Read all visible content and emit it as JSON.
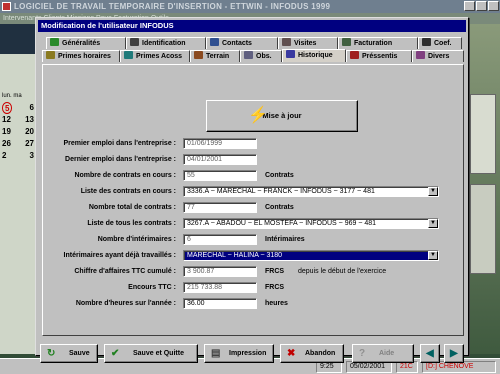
{
  "app": {
    "title": "LOGICIEL DE TRAVAIL TEMPORAIRE D'INSERTION - ETTWIN - INFODUS 1999",
    "menu": "Intervenants   Clients   Missions   Paye   Facturation   Outils",
    "calendar": {
      "header": "lun.  ma",
      "days": [
        "5",
        "12",
        "19",
        "26",
        "2"
      ],
      "rows_right": [
        "6",
        "13",
        "20",
        "27",
        "3"
      ]
    }
  },
  "dialog": {
    "title": "Modification de l'utilisateur INFODUS",
    "tabs_row1": [
      "Généralités",
      "Identification",
      "Contacts",
      "Visites",
      "Facturation",
      "Coef."
    ],
    "tabs_row2": [
      "Primes horaires",
      "Primes Acoss",
      "Terrain",
      "Obs.",
      "Historique",
      "Préssentis",
      "Divers"
    ],
    "update_button": "Mise à jour",
    "fields": {
      "premier_emploi": {
        "label": "Premier emploi dans l'entreprise :",
        "value": "01/06/1999"
      },
      "dernier_emploi": {
        "label": "Dernier emploi dans l'entreprise :",
        "value": "04/01/2001"
      },
      "nb_contrats_en_cours": {
        "label": "Nombre de contrats en cours :",
        "value": "55",
        "unit": "Contrats"
      },
      "liste_contrats_en_cours": {
        "label": "Liste des contrats en cours :",
        "value": "3336.A ~ MARECHAL ~ FRANCK ~ INFODUS ~ 3177 ~ 481"
      },
      "nb_total_contrats": {
        "label": "Nombre total de contrats :",
        "value": "77",
        "unit": "Contrats"
      },
      "liste_tous_contrats": {
        "label": "Liste de tous les contrats :",
        "value": "3267.A ~ ABADOU ~ EL MOSTEFA ~ INFODUS ~ 969 ~ 481"
      },
      "nb_interimaires": {
        "label": "Nombre d'intérimaires :",
        "value": "6",
        "unit": "Intérimaires"
      },
      "interimaires_travailles": {
        "label": "Intérimaires ayant déjà travaillés :",
        "value": "MARECHAL ~ HALINA ~ 3180"
      },
      "chiffre_affaires": {
        "label": "Chiffre d'affaires TTC cumulé :",
        "value": "3 900.87",
        "unit": "FRCS",
        "note": "depuis le début de l'exercice"
      },
      "encours_ttc": {
        "label": "Encours TTC :",
        "value": "215 733.88",
        "unit": "FRCS"
      },
      "nb_heures_annee": {
        "label": "Nombre d'heures sur l'année :",
        "value": "36.00",
        "unit": "heures"
      }
    },
    "buttons": {
      "sauve": "Sauve",
      "sauve_quitte": "Sauve et Quitte",
      "impression": "Impression",
      "abandon": "Abandon",
      "aide": "Aide"
    }
  },
  "status": {
    "time": "9:25",
    "date": "05/02/2001",
    "code": "21C",
    "drive": "[D:] CHENOVE"
  }
}
